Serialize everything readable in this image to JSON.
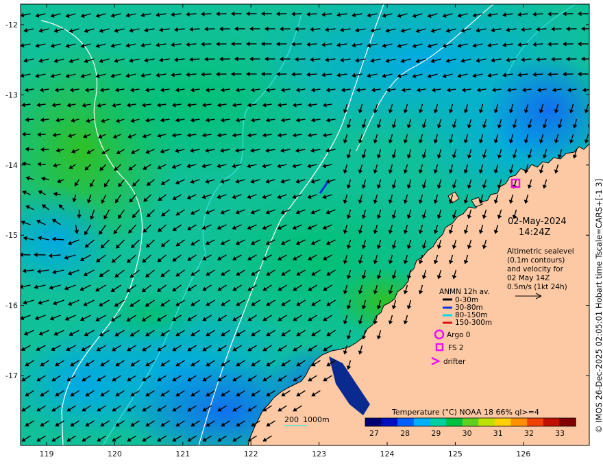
{
  "map": {
    "region": "North-west Australian shelf",
    "lon_ticks": [
      "119",
      "120",
      "121",
      "122",
      "123",
      "124",
      "125",
      "126"
    ],
    "lat_ticks": [
      "-12",
      "-13",
      "-14",
      "-15",
      "-16",
      "-17"
    ]
  },
  "datetime": {
    "date": "02-May-2024",
    "time": "14:24Z"
  },
  "description": {
    "lines": [
      "Altimetric sealevel",
      "(0.1m contours)",
      "and velocity for",
      "02 May 14Z",
      "0.5m/s (1kt 24h)"
    ]
  },
  "anmn_legend": {
    "title": "ANMN 12h av.",
    "items": [
      {
        "label": "0-30m",
        "color": "#000000"
      },
      {
        "label": "30-80m",
        "color": "#1030e0"
      },
      {
        "label": "80-150m",
        "color": "#00d8e8"
      },
      {
        "label": "150-300m",
        "color": "#e01010"
      }
    ]
  },
  "markers": {
    "argo_label": "Argo 0",
    "fs_label": "FS 2",
    "drifter_label": "drifter",
    "color": "#ee10ee"
  },
  "depth_contours": {
    "label_200": "200",
    "label_1000": "1000m"
  },
  "colorbar": {
    "title": "Temperature (°C) NOAA 18 66% ql>=4",
    "ticks": [
      "27",
      "28",
      "29",
      "30",
      "31",
      "32",
      "33"
    ],
    "colors": [
      "#000070",
      "#0010c0",
      "#0060ff",
      "#00b0ff",
      "#00d0a0",
      "#00c040",
      "#60d020",
      "#c0e000",
      "#ffd000",
      "#ff9000",
      "#f04000",
      "#c01000",
      "#800000"
    ]
  },
  "side_label": "© IMOS 26-Dec-2025 02:05:01 Hobart time Tscale=CARS+[-1 3]"
}
